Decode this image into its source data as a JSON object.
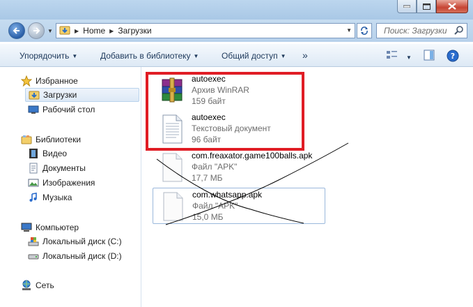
{
  "address": {
    "crumbs": [
      "Home",
      "Загрузки"
    ],
    "search_placeholder": "Поиск: Загрузки"
  },
  "toolbar": {
    "organize": "Упорядочить",
    "add_to_library": "Добавить в библиотеку",
    "share": "Общий доступ",
    "more": "»"
  },
  "nav": {
    "favorites": "Избранное",
    "downloads": "Загрузки",
    "desktop": "Рабочий стол",
    "libraries": "Библиотеки",
    "video": "Видео",
    "documents": "Документы",
    "images": "Изображения",
    "music": "Музыка",
    "computer": "Компьютер",
    "disk_c": "Локальный диск (C:)",
    "disk_d": "Локальный диск (D:)",
    "network": "Сеть"
  },
  "files": [
    {
      "name": "autoexec",
      "type": "Архив WinRAR",
      "size": "159 байт",
      "icon": "winrar-archive-icon"
    },
    {
      "name": "autoexec",
      "type": "Текстовый документ",
      "size": "96 байт",
      "icon": "text-document-icon"
    },
    {
      "name": "com.freaxator.game100balls.apk",
      "type": "Файл \"APK\"",
      "size": "17,7 МБ",
      "icon": "generic-file-icon"
    },
    {
      "name": "com.whatsapp.apk",
      "type": "Файл \"APK\"",
      "size": "15,0 МБ",
      "icon": "generic-file-icon"
    }
  ],
  "colors": {
    "highlight_box": "#e01d25",
    "toolbar_text": "#1e395b",
    "secondary_text": "#6d6d6d"
  }
}
